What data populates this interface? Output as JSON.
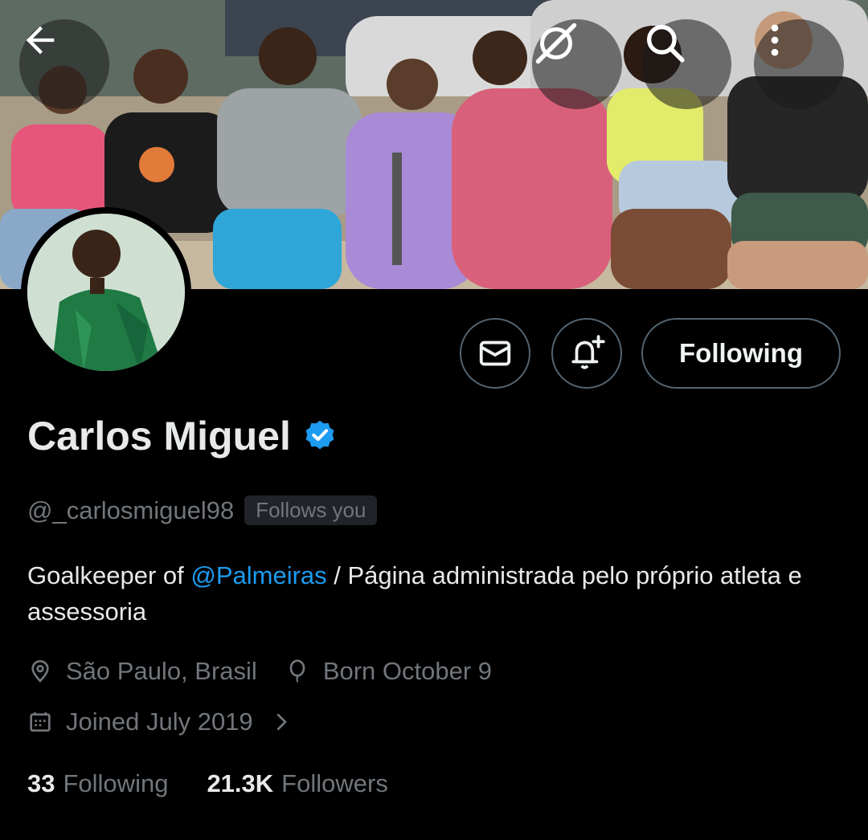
{
  "header": {
    "back_icon": "arrow-left-icon",
    "grok_icon": "slashed-circle-icon",
    "search_icon": "search-icon",
    "more_icon": "vertical-dots-icon"
  },
  "actions": {
    "message_icon": "envelope-icon",
    "notify_icon": "bell-plus-icon",
    "follow_label": "Following"
  },
  "profile": {
    "name": "Carlos Miguel",
    "handle": "@_carlosmiguel98",
    "follows_you": "Follows you",
    "bio_before": "Goalkeeper of ",
    "bio_mention": "@Palmeiras",
    "bio_after": " / Página administrada pelo próprio atleta e assessoria",
    "location": "São Paulo, Brasil",
    "birthday": "Born October 9",
    "joined": "Joined July 2019",
    "following_count": "33",
    "following_label": "Following",
    "followers_count": "21.3K",
    "followers_label": "Followers"
  },
  "colors": {
    "accent": "#1d9bf0",
    "muted": "#71767b",
    "background": "#000000"
  }
}
